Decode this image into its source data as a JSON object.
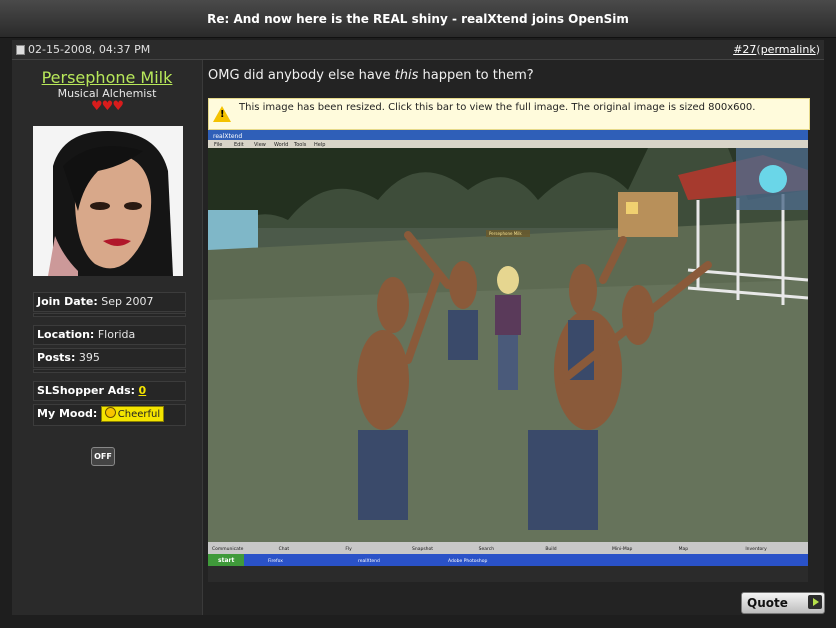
{
  "thread": {
    "title": "Re: And now here is the REAL shiny - realXtend joins OpenSim"
  },
  "post": {
    "date": "02-15-2008, 04:37 PM",
    "number": "#27",
    "open_paren": "(",
    "permalink_label": "permalink",
    "close_paren": ")",
    "message_before": "OMG did anybody else have ",
    "message_emphasis": "this",
    "message_after": " happen to them?",
    "resize_notice": "This image has been resized. Click this bar to view the full image. The original image is sized 800x600.",
    "quote_label": "Quote"
  },
  "user": {
    "name": "Persephone Milk",
    "title": "Musical Alchemist",
    "hearts": "♥♥♥",
    "join_date_label": "Join Date:",
    "join_date": "Sep 2007",
    "location_label": "Location:",
    "location": "Florida",
    "posts_label": "Posts:",
    "posts": "395",
    "ads_label": "SLShopper Ads:",
    "ads": "0",
    "mood_label": "My Mood:",
    "mood": "Cheerful",
    "off_label": "OFF"
  },
  "screenshot": {
    "window_title": "realXtend",
    "menu": [
      "File",
      "Edit",
      "View",
      "World",
      "Tools",
      "Help"
    ],
    "name_tag": "Persephone Milk",
    "bottom_buttons": [
      "Communicate",
      "Chat",
      "Fly",
      "Snapshot",
      "Search",
      "Build",
      "Mini-Map",
      "Map",
      "Inventory"
    ],
    "taskbar_start": "start",
    "taskbar_items": [
      "Firefox",
      "realXtend",
      "Adobe Photoshop"
    ]
  },
  "colors": {
    "username": "#b8e85a",
    "mood_badge": "#f4e400",
    "hearts": "#d81c1c"
  }
}
